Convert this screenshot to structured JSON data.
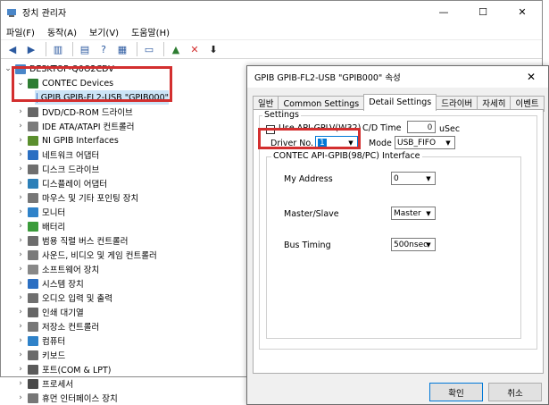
{
  "device_manager": {
    "title": "장치 관리자",
    "window_controls": {
      "minimize": "—",
      "maximize": "☐",
      "close": "✕"
    },
    "menu": [
      "파일(F)",
      "동작(A)",
      "보기(V)",
      "도움말(H)"
    ],
    "root": "DESKTOP-Q0O2CDV",
    "tree": [
      {
        "label": "CONTEC Devices",
        "expanded": true,
        "color": "#2e7d32"
      },
      {
        "label": "GPIB GPIB-FL2-USB \"GPIB000\"",
        "child": true,
        "selected": true,
        "color": "#3f76c8"
      },
      {
        "label": "DVD/CD-ROM 드라이브",
        "color": "#666666"
      },
      {
        "label": "IDE ATA/ATAPI 컨트롤러",
        "color": "#7b7b7b"
      },
      {
        "label": "NI GPIB Interfaces",
        "color": "#5b8f2e"
      },
      {
        "label": "네트워크 어댑터",
        "color": "#2b6fc2"
      },
      {
        "label": "디스크 드라이브",
        "color": "#6f6f6f"
      },
      {
        "label": "디스플레이 어댑터",
        "color": "#2c7fb8"
      },
      {
        "label": "마우스 및 기타 포인팅 장치",
        "color": "#777777"
      },
      {
        "label": "모니터",
        "color": "#2f82c9"
      },
      {
        "label": "배터리",
        "color": "#3a9b3a"
      },
      {
        "label": "범용 직렬 버스 컨트롤러",
        "color": "#6d6d6d"
      },
      {
        "label": "사운드, 비디오 및 게임 컨트롤러",
        "color": "#7a7a7a"
      },
      {
        "label": "소프트웨어 장치",
        "color": "#888888"
      },
      {
        "label": "시스템 장치",
        "color": "#2b6fc2"
      },
      {
        "label": "오디오 입력 및 출력",
        "color": "#6f6f6f"
      },
      {
        "label": "인쇄 대기열",
        "color": "#666666"
      },
      {
        "label": "저장소 컨트롤러",
        "color": "#777777"
      },
      {
        "label": "컴퓨터",
        "color": "#2f82c9"
      },
      {
        "label": "키보드",
        "color": "#6a6a6a"
      },
      {
        "label": "포트(COM & LPT)",
        "color": "#5a5a5a"
      },
      {
        "label": "프로세서",
        "color": "#4a4a4a"
      },
      {
        "label": "휴먼 인터페이스 장치",
        "color": "#777777"
      }
    ]
  },
  "dialog": {
    "title": "GPIB GPIB-FL2-USB \"GPIB000\" 속성",
    "close": "✕",
    "tabs": [
      "일반",
      "Common Settings",
      "Detail Settings",
      "드라이버",
      "자세히",
      "이벤트"
    ],
    "active_tab": "Detail Settings",
    "settings_group": "Settings",
    "use_api_label": "Use API-GPLV(W32)",
    "cd_time_label": "C/D Time",
    "cd_time_value": "0",
    "cd_time_unit": "uSec",
    "driver_no_label": "Driver No.",
    "driver_no_value": "1",
    "mode_label": "Mode",
    "mode_value": "USB_FIFO",
    "interface_group": "CONTEC API-GPIB(98/PC) Interface",
    "my_address_label": "My Address",
    "my_address_value": "0",
    "master_slave_label": "Master/Slave",
    "master_slave_value": "Master",
    "bus_timing_label": "Bus Timing",
    "bus_timing_value": "500nsec",
    "ok": "확인",
    "cancel": "취소"
  },
  "colors": {
    "highlight_box": "#d32f2f",
    "selection": "#cce4f7",
    "accent": "#0078d7"
  }
}
